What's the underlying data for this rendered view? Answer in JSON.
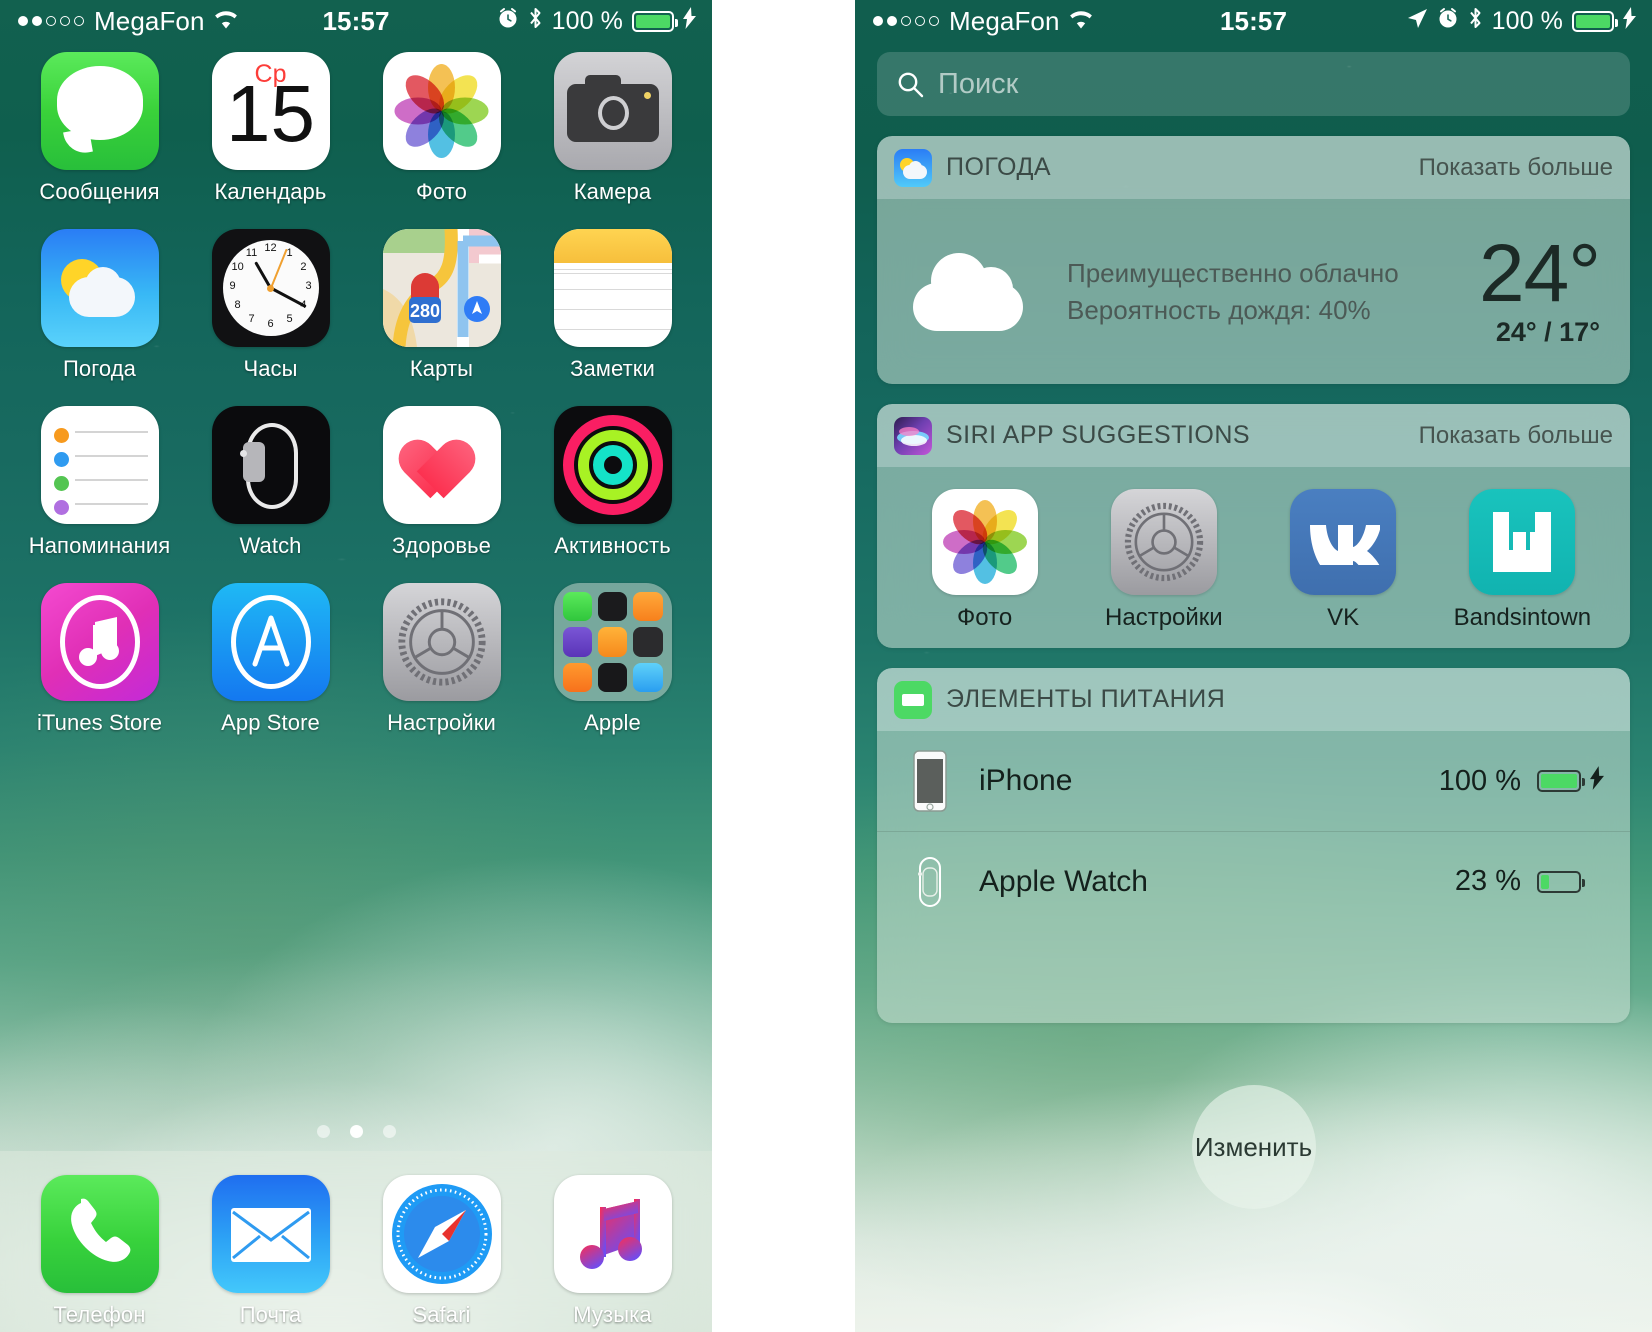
{
  "status_bar": {
    "signal_dots_filled": 2,
    "signal_dots_total": 5,
    "carrier": "MegaFon",
    "wifi_icon": "wifi-icon",
    "time": "15:57",
    "location_icon": "location-arrow-icon",
    "alarm_icon": "alarm-clock-icon",
    "bluetooth_icon": "bluetooth-icon",
    "battery_percent": "100 %",
    "battery_level": 100,
    "charging_icon": "lightning-bolt-icon"
  },
  "home_screen": {
    "apps": [
      {
        "label": "Сообщения",
        "icon": "messages-icon"
      },
      {
        "label": "Календарь",
        "icon": "calendar-icon",
        "day": "Ср",
        "date": "15"
      },
      {
        "label": "Фото",
        "icon": "photos-icon"
      },
      {
        "label": "Камера",
        "icon": "camera-icon"
      },
      {
        "label": "Погода",
        "icon": "weather-icon"
      },
      {
        "label": "Часы",
        "icon": "clock-icon"
      },
      {
        "label": "Карты",
        "icon": "maps-icon",
        "route": "280"
      },
      {
        "label": "Заметки",
        "icon": "notes-icon"
      },
      {
        "label": "Напоминания",
        "icon": "reminders-icon"
      },
      {
        "label": "Watch",
        "icon": "watch-icon"
      },
      {
        "label": "Здоровье",
        "icon": "health-icon"
      },
      {
        "label": "Активность",
        "icon": "activity-icon"
      },
      {
        "label": "iTunes Store",
        "icon": "itunes-store-icon"
      },
      {
        "label": "App Store",
        "icon": "app-store-icon"
      },
      {
        "label": "Настройки",
        "icon": "settings-icon"
      },
      {
        "label": "Apple",
        "icon": "apple-folder-icon"
      }
    ],
    "page_dots": {
      "count": 3,
      "active_index": 1
    },
    "dock": [
      {
        "label": "Телефон",
        "icon": "phone-icon"
      },
      {
        "label": "Почта",
        "icon": "mail-icon"
      },
      {
        "label": "Safari",
        "icon": "safari-icon"
      },
      {
        "label": "Музыка",
        "icon": "music-icon"
      }
    ]
  },
  "today_view": {
    "search": {
      "placeholder": "Поиск",
      "value": "",
      "icon": "search-icon"
    },
    "widgets": [
      {
        "id": "weather",
        "icon": "weather-app-icon",
        "title": "ПОГОДА",
        "show_more": "Показать больше",
        "condition": "Преимущественно облачно",
        "precipitation": "Вероятность дождя: 40%",
        "temp": "24°",
        "high_low": "24° / 17°",
        "condition_icon": "cloud-icon"
      },
      {
        "id": "siri-suggestions",
        "icon": "siri-icon",
        "title": "SIRI APP SUGGESTIONS",
        "show_more": "Показать больше",
        "apps": [
          {
            "label": "Фото",
            "icon": "photos-icon"
          },
          {
            "label": "Настройки",
            "icon": "settings-icon"
          },
          {
            "label": "VK",
            "icon": "vk-icon"
          },
          {
            "label": "Bandsintown",
            "icon": "bandsintown-icon"
          }
        ]
      },
      {
        "id": "batteries",
        "icon": "battery-icon",
        "title": "ЭЛЕМЕНТЫ ПИТАНИЯ",
        "show_more": "",
        "devices": [
          {
            "name": "iPhone",
            "percent": "100 %",
            "level": 100,
            "charging": true,
            "icon": "iphone-icon"
          },
          {
            "name": "Apple Watch",
            "percent": "23 %",
            "level": 23,
            "charging": false,
            "icon": "apple-watch-icon"
          }
        ]
      }
    ],
    "edit_button": {
      "label": "Изменить"
    }
  },
  "colors": {
    "battery_green": "#4cd964",
    "calendar_red": "#fc3d39",
    "vk_blue": "#4a7fc1",
    "bandsintown_teal": "#19c3bd"
  }
}
